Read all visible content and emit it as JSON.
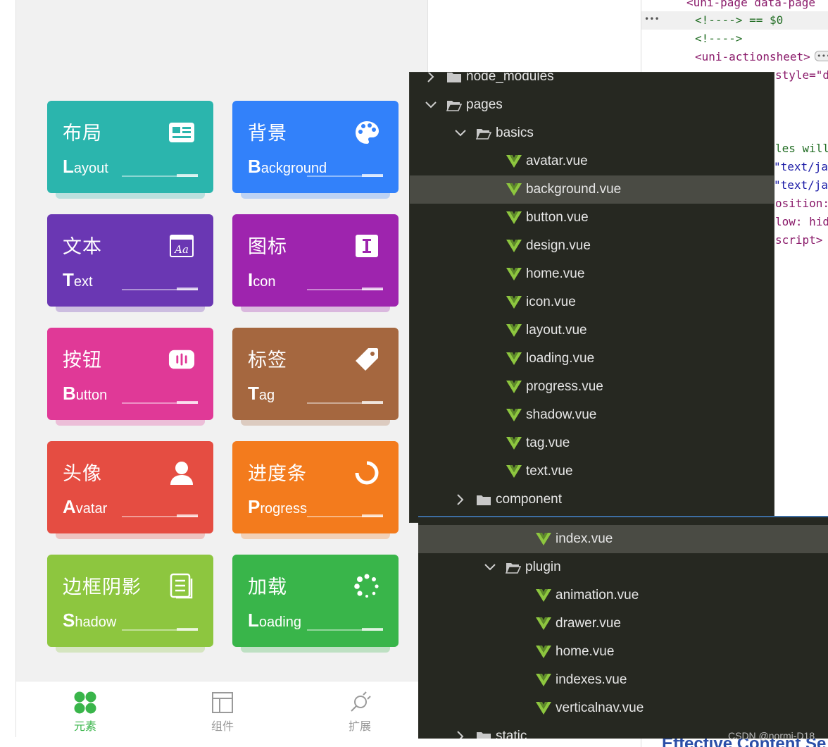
{
  "cards": [
    {
      "zh": "布局",
      "en_first": "L",
      "en_rest": "ayout",
      "icon": "newspaper-icon",
      "color": "#2bb5ad"
    },
    {
      "zh": "背景",
      "en_first": "B",
      "en_rest": "ackground",
      "icon": "palette-icon",
      "color": "#3281fa"
    },
    {
      "zh": "文本",
      "en_first": "T",
      "en_rest": "ext",
      "icon": "text-window-icon",
      "color": "#6a37b3"
    },
    {
      "zh": "图标",
      "en_first": "I",
      "en_rest": "con",
      "icon": "text-cursor-icon",
      "color": "#9e24ae"
    },
    {
      "zh": "按钮",
      "en_first": "B",
      "en_rest": "utton",
      "icon": "button-icon",
      "color": "#e03997"
    },
    {
      "zh": "标签",
      "en_first": "T",
      "en_rest": "ag",
      "icon": "tag-icon",
      "color": "#a5673f"
    },
    {
      "zh": "头像",
      "en_first": "A",
      "en_rest": "vatar",
      "icon": "user-icon",
      "color": "#e54d42"
    },
    {
      "zh": "进度条",
      "en_first": "P",
      "en_rest": "rogress",
      "icon": "progress-ring-icon",
      "color": "#f37b1d"
    },
    {
      "zh": "边框阴影",
      "en_first": "S",
      "en_rest": "hadow",
      "icon": "document-icon",
      "color": "#8dc63f"
    },
    {
      "zh": "加载",
      "en_first": "L",
      "en_rest": "oading",
      "icon": "spinner-icon",
      "color": "#39b54a"
    }
  ],
  "tabbar": [
    {
      "label": "元素",
      "icon": "elements-icon",
      "active": true
    },
    {
      "label": "组件",
      "icon": "layout-icon",
      "active": false
    },
    {
      "label": "扩展",
      "icon": "plugin-icon",
      "active": false
    }
  ],
  "devtools": {
    "lines": [
      {
        "text": "<uni-page data-page"
      },
      {
        "text": "<!----> == $0"
      },
      {
        "text": "<!---->"
      },
      {
        "text": "<uni-actionsheet>"
      },
      {
        "text": "style=\"d"
      },
      {
        "text": "les will"
      },
      {
        "text": "\"text/ja"
      },
      {
        "text": "\"text/ja"
      },
      {
        "text": "osition:"
      },
      {
        "text": "low: hid"
      },
      {
        "text": "script>"
      }
    ],
    "ellipsis": "•••",
    "more_badge": "•••",
    "bottom_text": "Effective Content Se"
  },
  "explorer_top": {
    "rows": [
      {
        "label": "node_modules",
        "type": "folder",
        "open": false
      },
      {
        "label": "pages",
        "type": "folder",
        "open": true
      },
      {
        "label": "basics",
        "type": "folder",
        "open": true
      },
      {
        "label": "avatar.vue",
        "type": "vue"
      },
      {
        "label": "background.vue",
        "type": "vue",
        "selected": true
      },
      {
        "label": "button.vue",
        "type": "vue"
      },
      {
        "label": "design.vue",
        "type": "vue"
      },
      {
        "label": "home.vue",
        "type": "vue"
      },
      {
        "label": "icon.vue",
        "type": "vue"
      },
      {
        "label": "layout.vue",
        "type": "vue"
      },
      {
        "label": "loading.vue",
        "type": "vue"
      },
      {
        "label": "progress.vue",
        "type": "vue"
      },
      {
        "label": "shadow.vue",
        "type": "vue"
      },
      {
        "label": "tag.vue",
        "type": "vue"
      },
      {
        "label": "text.vue",
        "type": "vue"
      },
      {
        "label": "component",
        "type": "folder",
        "open": false
      }
    ]
  },
  "explorer_bottom": {
    "rows": [
      {
        "label": "index.vue",
        "type": "vue",
        "selected": true
      },
      {
        "label": "plugin",
        "type": "folder",
        "open": true
      },
      {
        "label": "animation.vue",
        "type": "vue"
      },
      {
        "label": "drawer.vue",
        "type": "vue"
      },
      {
        "label": "home.vue",
        "type": "vue"
      },
      {
        "label": "indexes.vue",
        "type": "vue"
      },
      {
        "label": "verticalnav.vue",
        "type": "vue"
      },
      {
        "label": "static",
        "type": "folder",
        "open": false
      }
    ]
  },
  "watermark": "CSDN @normi-D18",
  "colors": {
    "explorer_bg": "#262821",
    "vue_green": "#8dc63f",
    "active_tab": "#39b54a"
  }
}
